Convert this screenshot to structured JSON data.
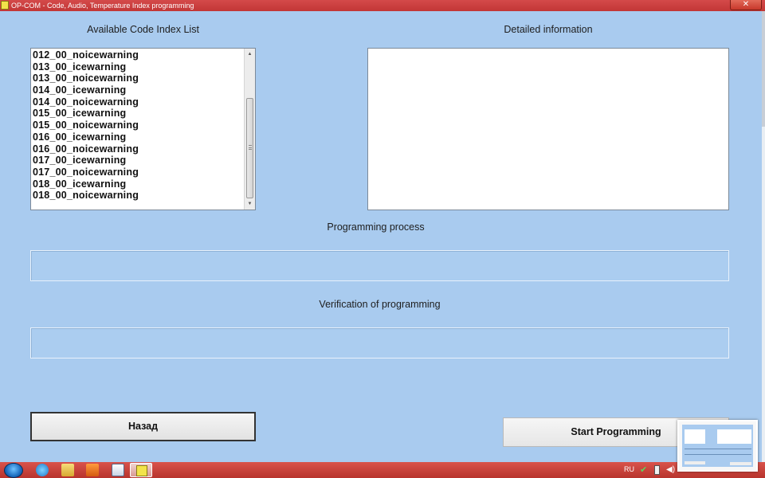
{
  "window": {
    "title": "OP-COM - Code, Audio, Temperature Index programming",
    "close_label": "✕"
  },
  "labels": {
    "code_list": "Available Code Index List",
    "detailed_info": "Detailed information",
    "programming_process": "Programming process",
    "verification": "Verification of programming"
  },
  "code_list": {
    "items": [
      "012_00_noicewarning",
      "013_00_icewarning",
      "013_00_noicewarning",
      "014_00_icewarning",
      "014_00_noicewarning",
      "015_00_icewarning",
      "015_00_noicewarning",
      "016_00_icewarning",
      "016_00_noicewarning",
      "017_00_icewarning",
      "017_00_noicewarning",
      "018_00_icewarning",
      "018_00_noicewarning"
    ]
  },
  "detailed_info": {
    "text": ""
  },
  "progress": {
    "programming": 0,
    "verification": 0
  },
  "buttons": {
    "back": "Назад",
    "start": "Start Programming"
  },
  "taskbar": {
    "language": "RU"
  },
  "icons": {
    "app": "op-com-icon",
    "close": "close-icon",
    "start": "windows-start-icon",
    "browser": "internet-explorer-icon",
    "folder": "folder-icon",
    "media": "media-player-icon",
    "check": "check-icon",
    "battery": "battery-icon",
    "volume": "volume-icon"
  },
  "colors": {
    "window_bg": "#a9cbef",
    "titlebar": "#c23636",
    "taskbar": "#b8342d"
  }
}
